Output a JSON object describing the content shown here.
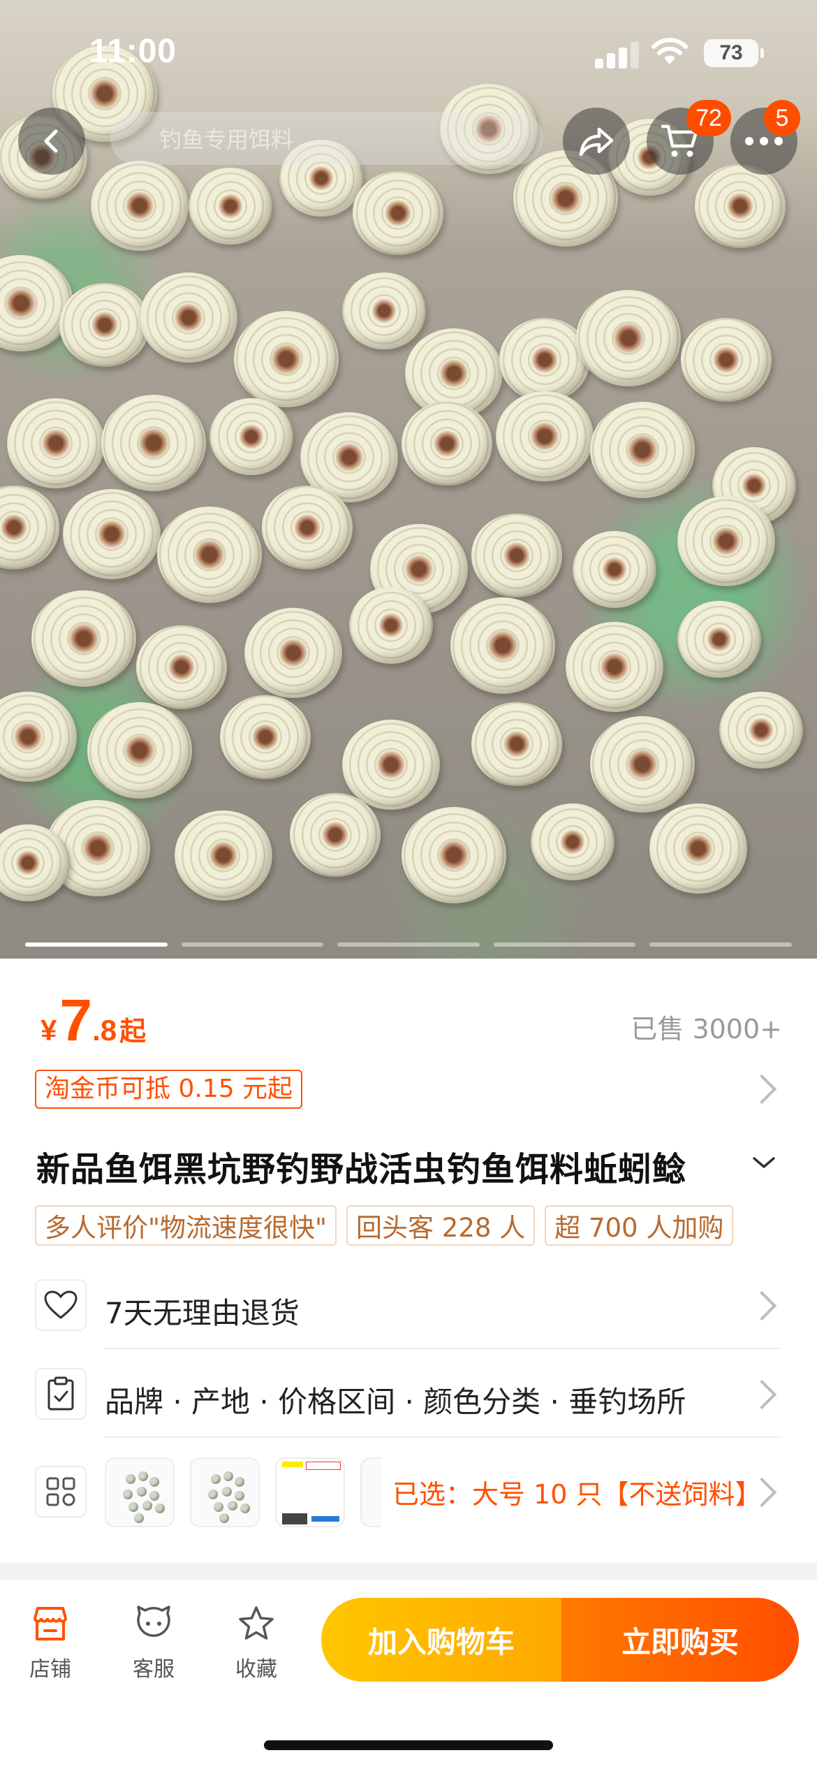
{
  "status_bar": {
    "time": "11:00",
    "battery": "73"
  },
  "nav": {
    "search_placeholder": "钓鱼专用饵料",
    "cart_badge": "72",
    "more_badge": "5"
  },
  "gallery": {
    "total_pages": 5,
    "current_page": 1
  },
  "price": {
    "currency": "¥",
    "integer": "7",
    "decimal": ".8",
    "suffix": "起",
    "sold": "已售 3000+"
  },
  "coin_tag": "淘金币可抵 0.15 元起",
  "product_title": "新品鱼饵黑坑野钓野战活虫钓鱼饵料蚯蚓鲶",
  "tags": [
    "多人评价\"物流速度很快\"",
    "回头客 228 人",
    "超 700 人加购"
  ],
  "service_rows": {
    "return_policy": "7天无理由退货",
    "params": "品牌 · 产地 · 价格区间 · 颜色分类 · 垂钓场所",
    "selected": "已选：大号 10 只【不送饲料】"
  },
  "bottom_bar": {
    "shop": "店铺",
    "service": "客服",
    "favorite": "收藏",
    "add_to_cart": "加入购物车",
    "buy_now": "立即购买"
  },
  "colors": {
    "accent": "#ff5000",
    "cart_button": "#ffb400",
    "buy_button": "#ff5a00",
    "tag_text": "#b8692e"
  }
}
